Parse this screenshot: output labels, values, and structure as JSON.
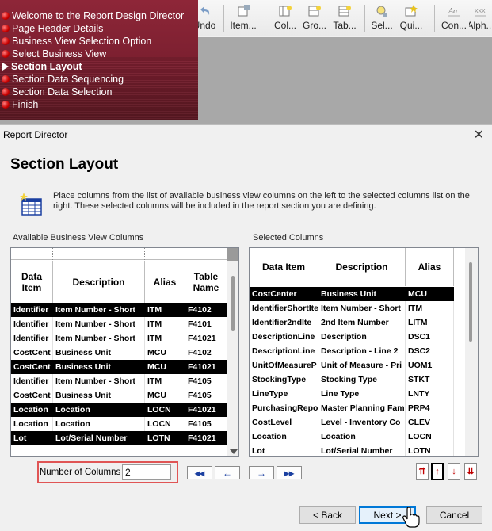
{
  "toolbar": {
    "buttons": [
      {
        "label": "Undo"
      },
      {
        "label": "Item..."
      },
      {
        "label": "Col..."
      },
      {
        "label": "Gro..."
      },
      {
        "label": "Tab..."
      },
      {
        "label": "Sel..."
      },
      {
        "label": "Qui..."
      },
      {
        "label": "Con..."
      },
      {
        "label": "Alph..."
      }
    ]
  },
  "steps": [
    {
      "label": "Welcome to the Report Design Director",
      "current": false
    },
    {
      "label": "Page Header Details",
      "current": false
    },
    {
      "label": "Business View Selection Option",
      "current": false
    },
    {
      "label": "Select Business View",
      "current": false
    },
    {
      "label": "Section Layout",
      "current": true
    },
    {
      "label": "Section Data Sequencing",
      "current": false
    },
    {
      "label": "Section Data Selection",
      "current": false
    },
    {
      "label": "Finish",
      "current": false
    }
  ],
  "dialog": {
    "title": "Report Director",
    "close_glyph": "✕",
    "page_title": "Section Layout",
    "info_text": "Place columns from the list of available business view columns on the left to the selected columns list on the right. These selected columns will be included in the report section you are defining."
  },
  "available": {
    "label": "Available Business View Columns",
    "headers": [
      "Data Item",
      "Description",
      "Alias",
      "Table Name"
    ],
    "rows": [
      {
        "cells": [
          "Identifier",
          "Item Number - Short",
          "ITM",
          "F4102"
        ],
        "selected": true
      },
      {
        "cells": [
          "Identifier",
          "Item Number - Short",
          "ITM",
          "F4101"
        ],
        "selected": false
      },
      {
        "cells": [
          "Identifier",
          "Item Number - Short",
          "ITM",
          "F41021"
        ],
        "selected": false
      },
      {
        "cells": [
          "CostCent",
          "Business Unit",
          "MCU",
          "F4102"
        ],
        "selected": false
      },
      {
        "cells": [
          "CostCent",
          "Business Unit",
          "MCU",
          "F41021"
        ],
        "selected": true
      },
      {
        "cells": [
          "Identifier",
          "Item Number - Short",
          "ITM",
          "F4105"
        ],
        "selected": false
      },
      {
        "cells": [
          "CostCent",
          "Business Unit",
          "MCU",
          "F4105"
        ],
        "selected": false
      },
      {
        "cells": [
          "Location",
          "Location",
          "LOCN",
          "F41021"
        ],
        "selected": true
      },
      {
        "cells": [
          "Location",
          "Location",
          "LOCN",
          "F4105"
        ],
        "selected": false
      },
      {
        "cells": [
          "Lot",
          "Lot/Serial Number",
          "LOTN",
          "F41021"
        ],
        "selected": true
      }
    ]
  },
  "selected": {
    "label": "Selected Columns",
    "headers": [
      "Data Item",
      "Description",
      "Alias"
    ],
    "rows": [
      {
        "cells": [
          "CostCenter",
          "Business Unit",
          "MCU"
        ],
        "selected": true
      },
      {
        "cells": [
          "IdentifierShortIte",
          "Item Number - Short",
          "ITM"
        ],
        "selected": false
      },
      {
        "cells": [
          "Identifier2ndIte",
          "2nd Item Number",
          "LITM"
        ],
        "selected": false
      },
      {
        "cells": [
          "DescriptionLine",
          "Description",
          "DSC1"
        ],
        "selected": false
      },
      {
        "cells": [
          "DescriptionLine",
          "Description - Line 2",
          "DSC2"
        ],
        "selected": false
      },
      {
        "cells": [
          "UnitOfMeasureP",
          "Unit of Measure - Pri",
          "UOM1"
        ],
        "selected": false
      },
      {
        "cells": [
          "StockingType",
          "Stocking Type",
          "STKT"
        ],
        "selected": false
      },
      {
        "cells": [
          "LineType",
          "Line Type",
          "LNTY"
        ],
        "selected": false
      },
      {
        "cells": [
          "PurchasingRepo",
          "Master Planning Fam",
          "PRP4"
        ],
        "selected": false
      },
      {
        "cells": [
          "CostLevel",
          "Level - Inventory Co",
          "CLEV"
        ],
        "selected": false
      },
      {
        "cells": [
          "Location",
          "Location",
          "LOCN"
        ],
        "selected": false
      },
      {
        "cells": [
          "Lot",
          "Lot/Serial Number",
          "LOTN"
        ],
        "selected": false
      }
    ]
  },
  "columns": {
    "label": "Number of Columns",
    "value": "2"
  },
  "move_buttons": {
    "remove_all": "◂◂",
    "remove": "←",
    "add": "→",
    "add_all": "▸▸"
  },
  "order_buttons": {
    "top": "⇈",
    "up": "↑",
    "down": "↓",
    "bottom": "⇊"
  },
  "buttons": {
    "back": "< Back",
    "next": "Next >",
    "cancel": "Cancel"
  },
  "colors": {
    "steps_bg": "#7a1f2f",
    "selection": "#000000",
    "highlight_box": "#e05555",
    "default_button": "#0078d7"
  }
}
